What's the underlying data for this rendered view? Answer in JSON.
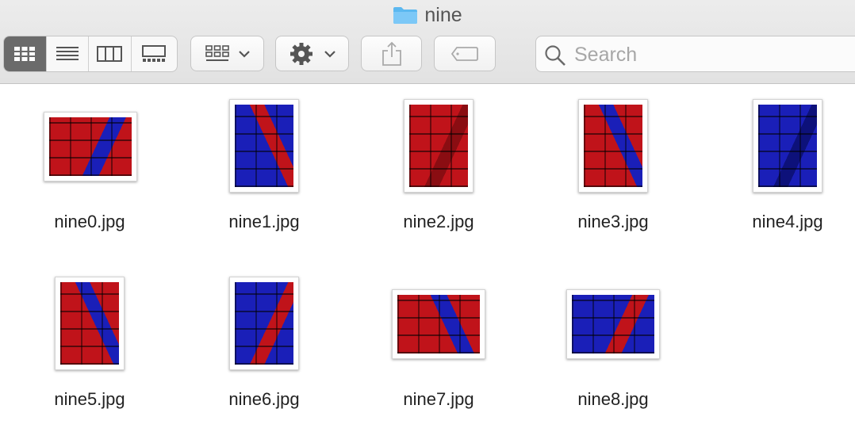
{
  "window": {
    "title": "nine",
    "folder_icon": "folder-icon"
  },
  "toolbar": {
    "view_modes": [
      {
        "name": "icon-view",
        "active": true
      },
      {
        "name": "list-view",
        "active": false
      },
      {
        "name": "column-view",
        "active": false
      },
      {
        "name": "gallery-view",
        "active": false
      }
    ],
    "group_icon": "group-by-icon",
    "action_icon": "gear-icon",
    "share_icon": "share-icon",
    "tag_icon": "tag-icon"
  },
  "search": {
    "placeholder": "Search"
  },
  "files": [
    {
      "name": "nine0.jpg",
      "orientation": "landscape",
      "colors": [
        "#c0131a",
        "#1a1fb8"
      ]
    },
    {
      "name": "nine1.jpg",
      "orientation": "portrait",
      "colors": [
        "#1a1fb8",
        "#c0131a"
      ]
    },
    {
      "name": "nine2.jpg",
      "orientation": "portrait",
      "colors": [
        "#c0131a",
        "#8a0d12"
      ]
    },
    {
      "name": "nine3.jpg",
      "orientation": "portrait",
      "colors": [
        "#c0131a",
        "#1a1fb8"
      ]
    },
    {
      "name": "nine4.jpg",
      "orientation": "portrait",
      "colors": [
        "#1a1fb8",
        "#0d117a"
      ]
    },
    {
      "name": "nine5.jpg",
      "orientation": "portrait",
      "colors": [
        "#c0131a",
        "#1a1fb8"
      ]
    },
    {
      "name": "nine6.jpg",
      "orientation": "portrait",
      "colors": [
        "#1a1fb8",
        "#c0131a"
      ]
    },
    {
      "name": "nine7.jpg",
      "orientation": "landscape",
      "colors": [
        "#c0131a",
        "#1a1fb8"
      ]
    },
    {
      "name": "nine8.jpg",
      "orientation": "landscape",
      "colors": [
        "#1a1fb8",
        "#c0131a"
      ]
    }
  ]
}
